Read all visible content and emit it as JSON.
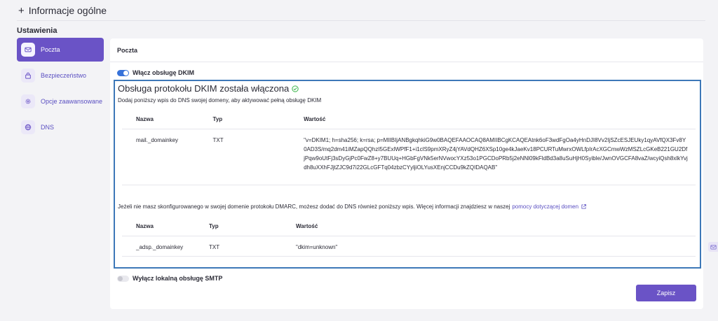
{
  "header": {
    "plus": "+",
    "title": "Informacje ogólne"
  },
  "settings_label": "Ustawienia",
  "sidebar": {
    "items": [
      {
        "label": "Poczta",
        "icon": "mail-icon",
        "active": true
      },
      {
        "label": "Bezpieczeństwo",
        "icon": "lock-icon",
        "active": false
      },
      {
        "label": "Opcje zaawansowane",
        "icon": "gear-icon",
        "active": false
      },
      {
        "label": "DNS",
        "icon": "globe-icon",
        "active": false
      }
    ]
  },
  "card": {
    "title": "Poczta",
    "dkim_toggle": {
      "label": "Włącz obsługę DKIM",
      "on": true
    },
    "dkim_box": {
      "title": "Obsługa protokołu DKIM została włączona",
      "description": "Dodaj poniższy wpis do DNS swojej domeny, aby aktywować pełną obsługę DKIM",
      "table1": {
        "headers": [
          "Nazwa",
          "Typ",
          "Wartość"
        ],
        "rows": [
          {
            "name": "mail._domainkey",
            "type": "TXT",
            "value": "\"v=DKIM1; h=sha256; k=rsa; p=MIIBIjANBgkqhkiG9w0BAQEFAAOCAQ8AMIIBCgKCAQEAtnk6oF3wdFgOa4yHnDJI8Vv2IjSZcESJEUky1qyAVfQX3Fv8Y0AD3S/mq2dm41iMZapQQhzI5GExlWPfF1+i1clS9pmXRyZ4jYAVdQHZ6XSp10ge4kJaeKv18PCURTuMwrxOWLfpIrAcXGCmwWzMSZLcGKeB221GU2DfjPqw9oUtFj3sDyGjPc0FwZ8+y7BUUq+HGbFgVNk5erNVwocYXz53o1PGCDoPRb5j2eNNl09kFldBd3a8uSuHjH0Syible/JwnOVGCFA8vaZ/wcyiQsh8xlkYvjdh8uXXhFJjtZJC9d7i22GLcGFTq04zbzCYyljiOLYusXEnjCCDu9kZQIDAQAB\""
          }
        ]
      },
      "dmarc": {
        "text": "Jeżeli nie masz skonfigurowanego w swojej domenie protokołu DMARC, możesz dodać do DNS również poniższy wpis. Więcej informacji znajdziesz w naszej",
        "link": "pomocy dotyczącej domen"
      },
      "table2": {
        "headers": [
          "Nazwa",
          "Typ",
          "Wartość"
        ],
        "rows": [
          {
            "name": "_adsp._domainkey",
            "type": "TXT",
            "value": "\"dkim=unknown\""
          }
        ]
      }
    },
    "smtp_toggle": {
      "label": "Wyłącz lokalną obsługę SMTP",
      "on": false
    },
    "save_label": "Zapisz"
  },
  "colors": {
    "accent": "#6a53c6",
    "toggle_on": "#3772d9",
    "box_border": "#3d78b8",
    "success": "#3bb54a"
  }
}
